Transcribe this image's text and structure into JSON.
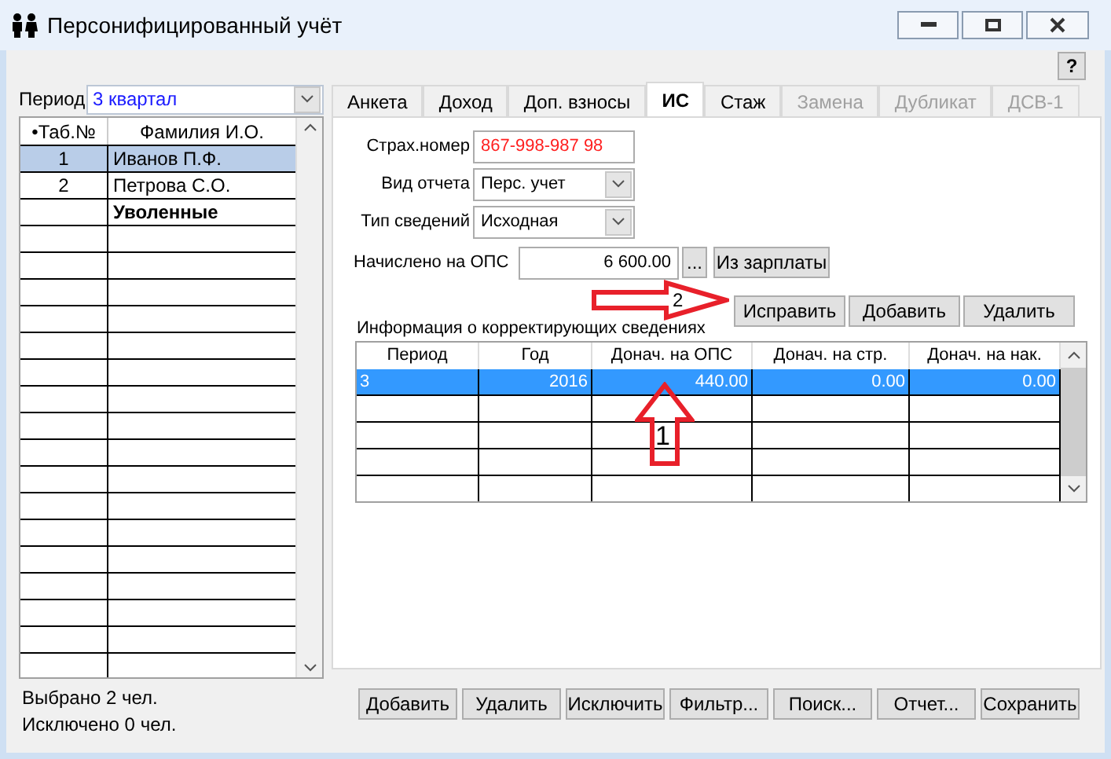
{
  "window": {
    "title": "Персонифицированный учёт"
  },
  "help_button": "?",
  "period": {
    "label": "Период",
    "value": "3 квартал"
  },
  "employees": {
    "columns": [
      "•Таб.№",
      "Фамилия И.О."
    ],
    "rows": [
      {
        "kind": "person",
        "number": "1",
        "name": "Иванов П.Ф.",
        "selected": true
      },
      {
        "kind": "person",
        "number": "2",
        "name": "Петрова С.О.",
        "selected": false
      },
      {
        "kind": "group",
        "name": "Уволенные",
        "selected": false
      }
    ]
  },
  "tabs": [
    {
      "label": "Анкета",
      "selected": false,
      "disabled": false
    },
    {
      "label": "Доход",
      "selected": false,
      "disabled": false
    },
    {
      "label": "Доп. взносы",
      "selected": false,
      "disabled": false
    },
    {
      "label": "ИС",
      "selected": true,
      "disabled": false
    },
    {
      "label": "Стаж",
      "selected": false,
      "disabled": false
    },
    {
      "label": "Замена",
      "selected": false,
      "disabled": true
    },
    {
      "label": "Дубликат",
      "selected": false,
      "disabled": true
    },
    {
      "label": "ДСВ-1",
      "selected": false,
      "disabled": true
    }
  ],
  "fields": [
    {
      "kind": "input",
      "label": "Страх.номер",
      "value": "867-998-987 98",
      "error": true
    },
    {
      "kind": "select",
      "label": "Вид отчета",
      "value": "Перс. учет",
      "error": false
    },
    {
      "kind": "select",
      "label": "Тип сведений",
      "value": "Исходная",
      "error": false
    }
  ],
  "accrued": {
    "label": "Начислено на ОПС",
    "value": "6 600.00",
    "ellipsis": "...",
    "button": "Из зарплаты"
  },
  "corrections": {
    "buttons": [
      "Исправить",
      "Добавить",
      "Удалить"
    ],
    "label": "Информация о корректирующих сведениях",
    "columns": [
      "Период",
      "Год",
      "Донач. на ОПС",
      "Донач. на стр.",
      "Донач. на нак."
    ],
    "rows": [
      {
        "cells": [
          "3",
          "2016",
          "440.00",
          "0.00",
          "0.00"
        ],
        "selected": true
      }
    ]
  },
  "annotations": [
    {
      "kind": "arrow-right",
      "label": "2"
    },
    {
      "kind": "arrow-up",
      "label": "1"
    }
  ],
  "status": [
    "Выбрано 2 чел.",
    "Исключено 0 чел."
  ],
  "footer_buttons": [
    "Добавить",
    "Удалить",
    "Исключить",
    "Фильтр...",
    "Поиск...",
    "Отчет...",
    "Сохранить"
  ]
}
